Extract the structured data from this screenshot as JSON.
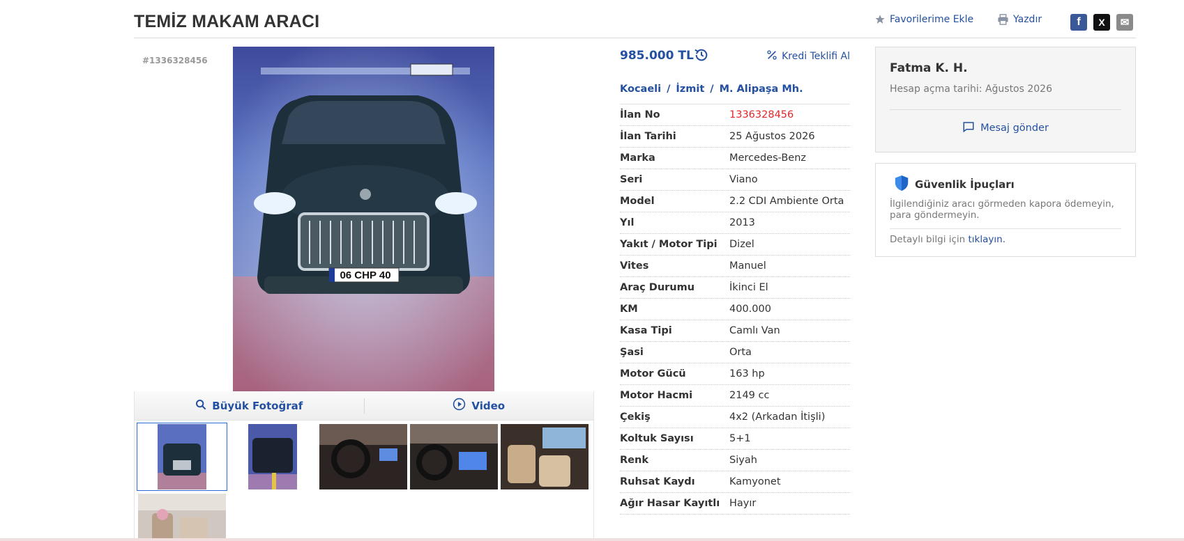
{
  "header": {
    "title": "TEMİZ MAKAM ARACI",
    "favorites_label": "Favorilerime Ekle",
    "print_label": "Yazdır",
    "social": [
      {
        "name": "facebook-share-button",
        "glyph": "f",
        "color": "#3b5998"
      },
      {
        "name": "x-share-button",
        "glyph": "X",
        "color": "#111111"
      },
      {
        "name": "email-share-button",
        "glyph": "✉",
        "color": "#8a8a8a"
      }
    ]
  },
  "listing": {
    "id_label": "#1336328456"
  },
  "gallery": {
    "large_photo_label": "Büyük Fotoğraf",
    "video_label": "Video",
    "thumbnails": [
      {
        "name": "thumb-front",
        "active": true
      },
      {
        "name": "thumb-rear",
        "active": false
      },
      {
        "name": "thumb-dashboard",
        "active": false
      },
      {
        "name": "thumb-dashboard-screen",
        "active": false
      },
      {
        "name": "thumb-interior-seats",
        "active": false
      },
      {
        "name": "thumb-interior-cabin",
        "active": false
      }
    ],
    "plate_text": "06 CHP 40"
  },
  "price": {
    "amount": "985.000 TL",
    "credit_label": "Kredi Teklifi Al"
  },
  "location": {
    "crumbs": [
      "Kocaeli",
      "İzmit",
      "M. Alipaşa Mh."
    ]
  },
  "details": [
    {
      "label": "İlan No",
      "value": "1336328456",
      "highlight": true
    },
    {
      "label": "İlan Tarihi",
      "value": "25 Ağustos 2026"
    },
    {
      "label": "Marka",
      "value": "Mercedes-Benz"
    },
    {
      "label": "Seri",
      "value": "Viano"
    },
    {
      "label": "Model",
      "value": "2.2 CDI Ambiente Orta"
    },
    {
      "label": "Yıl",
      "value": "2013"
    },
    {
      "label": "Yakıt / Motor Tipi",
      "value": "Dizel"
    },
    {
      "label": "Vites",
      "value": "Manuel"
    },
    {
      "label": "Araç Durumu",
      "value": "İkinci El"
    },
    {
      "label": "KM",
      "value": "400.000"
    },
    {
      "label": "Kasa Tipi",
      "value": "Camlı Van"
    },
    {
      "label": "Şasi",
      "value": "Orta"
    },
    {
      "label": "Motor Gücü",
      "value": "163 hp"
    },
    {
      "label": "Motor Hacmi",
      "value": "2149 cc"
    },
    {
      "label": "Çekiş",
      "value": "4x2 (Arkadan İtişli)"
    },
    {
      "label": "Koltuk Sayısı",
      "value": "5+1"
    },
    {
      "label": "Renk",
      "value": "Siyah"
    },
    {
      "label": "Ruhsat Kaydı",
      "value": "Kamyonet"
    },
    {
      "label": "Ağır Hasar Kayıtlı",
      "value": "Hayır"
    }
  ],
  "seller": {
    "name": "Fatma K. H.",
    "since": "Hesap açma tarihi: Ağustos 2026",
    "message_label": "Mesaj gönder"
  },
  "tips": {
    "title": "Güvenlik İpuçları",
    "text": "İlgilendiğiniz aracı görmeden kapora ödemeyin, para göndermeyin.",
    "more_prefix": "Detaylı bilgi için",
    "more_link": "tıklayın."
  },
  "colors": {
    "link": "#2350a0",
    "accent_red": "#e0262a"
  }
}
